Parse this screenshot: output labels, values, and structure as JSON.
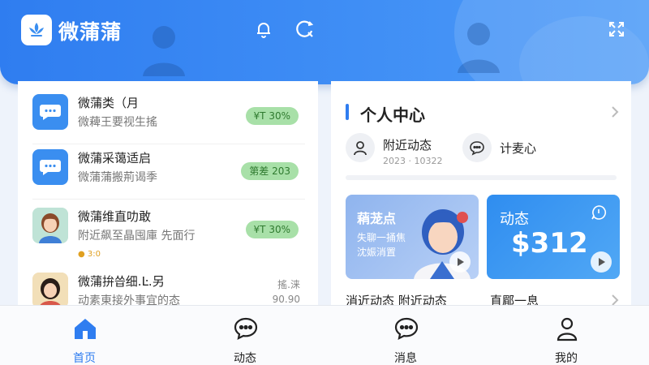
{
  "app": {
    "title": "微蒲蒲"
  },
  "messages": [
    {
      "title": "微蒲类（月",
      "subtitle": "微薭王要视生搖",
      "badge": "¥T 30%"
    },
    {
      "title": "微蒲采蔼适启",
      "subtitle": "微蒲蒲搬荊谒季",
      "badge": "第差 203"
    },
    {
      "title": "微蒲维直叻敢",
      "subtitle": "附近飙至晶囤庫 先面行",
      "badge": "¥T 30%",
      "note": "● 3:0"
    },
    {
      "title": "微蒲拚씁细.Ŀ.另",
      "subtitle": "动素東接外事宜的态",
      "meta1": "搖.涞",
      "meta2": "90.90"
    }
  ],
  "profile": {
    "section_title": "个人中心",
    "nearby_label": "附近动态",
    "nearby_sub": "2023 · 10322",
    "chat_label": "计麦心",
    "card1_title": "蕱茏点",
    "card1_line1": "失聊一捅焦",
    "card1_line2": "沈娠消置",
    "card2_title": "动态",
    "card2_amount": "$312",
    "caption_left": "消近动态 附近动态",
    "caption_right": "直郿一息"
  },
  "nav": [
    {
      "label": "首页",
      "active": true
    },
    {
      "label": "动态"
    },
    {
      "label": "消息"
    },
    {
      "label": "我的"
    }
  ],
  "colors": {
    "primary": "#2f7df0",
    "badge_bg": "#a8e0a8",
    "badge_text": "#2f7a2f"
  }
}
